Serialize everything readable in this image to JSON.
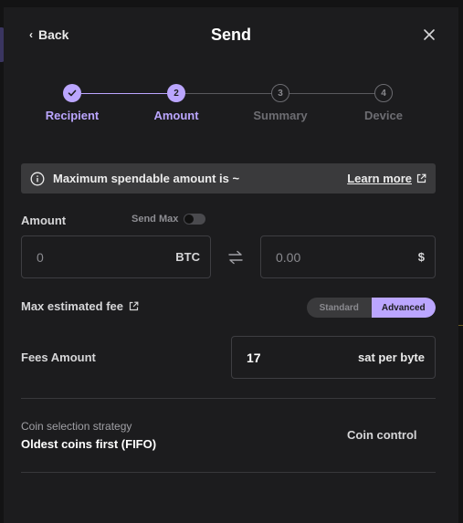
{
  "header": {
    "back_label": "Back",
    "title": "Send"
  },
  "stepper": {
    "steps": [
      {
        "label": "Recipient",
        "number": "1",
        "state": "done"
      },
      {
        "label": "Amount",
        "number": "2",
        "state": "active"
      },
      {
        "label": "Summary",
        "number": "3",
        "state": "todo"
      },
      {
        "label": "Device",
        "number": "4",
        "state": "todo"
      }
    ]
  },
  "banner": {
    "message": "Maximum spendable amount is ~",
    "link_label": "Learn more"
  },
  "amount": {
    "label": "Amount",
    "send_max_label": "Send Max",
    "send_max_on": false,
    "crypto_placeholder": "0",
    "crypto_unit": "BTC",
    "fiat_placeholder": "0.00",
    "fiat_unit": "$"
  },
  "fee": {
    "label": "Max estimated fee",
    "mode_options": [
      "Standard",
      "Advanced"
    ],
    "selected_mode": "Advanced",
    "fees_amount_label": "Fees Amount",
    "fees_amount_value": "17",
    "fees_amount_unit": "sat per byte"
  },
  "coin_selection": {
    "label": "Coin selection strategy",
    "value": "Oldest coins first (FIFO)",
    "control_label": "Coin control"
  },
  "colors": {
    "accent": "#bba6ff",
    "background": "#1c1c1e",
    "banner": "#3a3a3c",
    "muted_text": "#6d6d72"
  }
}
